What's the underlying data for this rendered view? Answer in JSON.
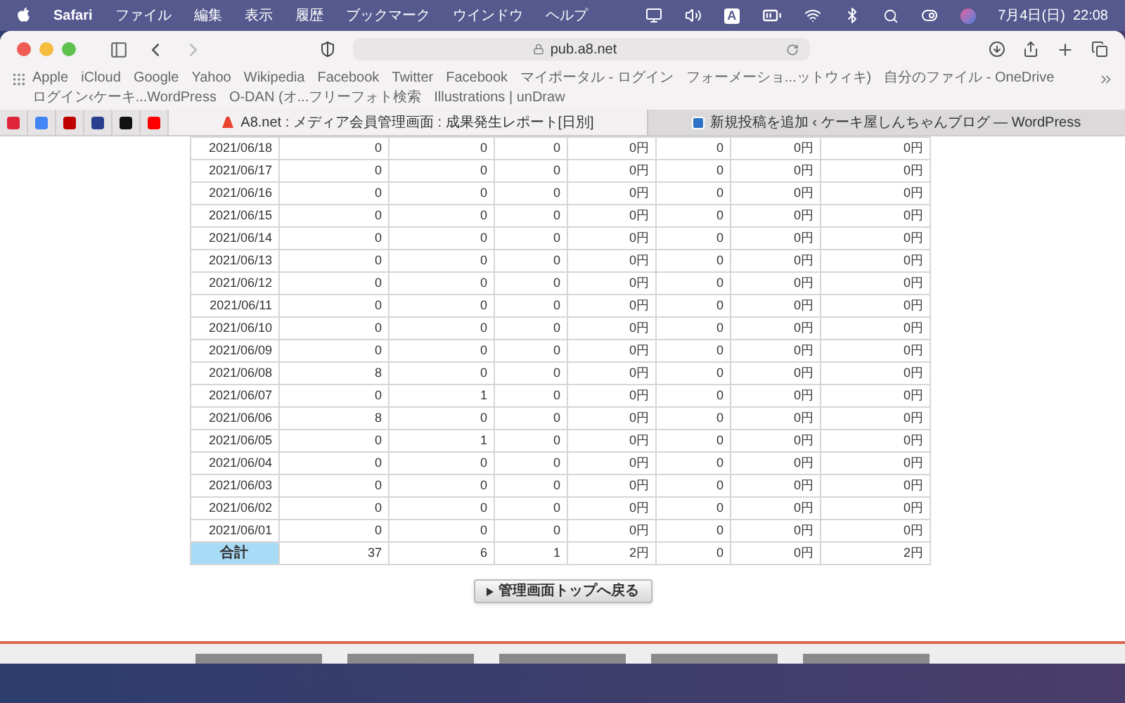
{
  "menu_bar": {
    "app": "Safari",
    "items": [
      "ファイル",
      "編集",
      "表示",
      "履歴",
      "ブックマーク",
      "ウインドウ",
      "ヘルプ"
    ],
    "input_source": "A",
    "clock": "7月4日(日)  22:08"
  },
  "address_bar": {
    "url": "pub.a8.net"
  },
  "bookmarks": [
    "Apple",
    "iCloud",
    "Google",
    "Yahoo",
    "Wikipedia",
    "Facebook",
    "Twitter",
    "Facebook",
    "マイポータル - ログイン",
    "フォーメーショ...ットウィキ)",
    "自分のファイル - OneDrive",
    "ログイン‹ケーキ...WordPress",
    "O-DAN (オ...フリーフォト検索",
    "Illustrations | unDraw"
  ],
  "pinned_tabs": [
    {
      "color": "#e0243a"
    },
    {
      "color": "#4285f4"
    },
    {
      "color": "#bf0000"
    },
    {
      "color": "#2a3f8f"
    },
    {
      "color": "#111111"
    },
    {
      "color": "#ff0000"
    }
  ],
  "tabs": [
    {
      "title": "A8.net : メディア会員管理画面 : 成果発生レポート[日別]",
      "selected": true
    },
    {
      "title": "新規投稿を追加 ‹ ケーキ屋しんちゃんブログ — WordPress",
      "selected": false
    }
  ],
  "table": {
    "rows": [
      {
        "date": "2021/06/18",
        "cells": [
          "0",
          "0",
          "0",
          "0円",
          "0",
          "0円",
          "0円"
        ]
      },
      {
        "date": "2021/06/17",
        "cells": [
          "0",
          "0",
          "0",
          "0円",
          "0",
          "0円",
          "0円"
        ]
      },
      {
        "date": "2021/06/16",
        "cells": [
          "0",
          "0",
          "0",
          "0円",
          "0",
          "0円",
          "0円"
        ]
      },
      {
        "date": "2021/06/15",
        "cells": [
          "0",
          "0",
          "0",
          "0円",
          "0",
          "0円",
          "0円"
        ]
      },
      {
        "date": "2021/06/14",
        "cells": [
          "0",
          "0",
          "0",
          "0円",
          "0",
          "0円",
          "0円"
        ]
      },
      {
        "date": "2021/06/13",
        "cells": [
          "0",
          "0",
          "0",
          "0円",
          "0",
          "0円",
          "0円"
        ]
      },
      {
        "date": "2021/06/12",
        "cells": [
          "0",
          "0",
          "0",
          "0円",
          "0",
          "0円",
          "0円"
        ]
      },
      {
        "date": "2021/06/11",
        "cells": [
          "0",
          "0",
          "0",
          "0円",
          "0",
          "0円",
          "0円"
        ]
      },
      {
        "date": "2021/06/10",
        "cells": [
          "0",
          "0",
          "0",
          "0円",
          "0",
          "0円",
          "0円"
        ]
      },
      {
        "date": "2021/06/09",
        "cells": [
          "0",
          "0",
          "0",
          "0円",
          "0",
          "0円",
          "0円"
        ]
      },
      {
        "date": "2021/06/08",
        "cells": [
          "8",
          "0",
          "0",
          "0円",
          "0",
          "0円",
          "0円"
        ]
      },
      {
        "date": "2021/06/07",
        "cells": [
          "0",
          "1",
          "0",
          "0円",
          "0",
          "0円",
          "0円"
        ]
      },
      {
        "date": "2021/06/06",
        "cells": [
          "8",
          "0",
          "0",
          "0円",
          "0",
          "0円",
          "0円"
        ]
      },
      {
        "date": "2021/06/05",
        "cells": [
          "0",
          "1",
          "0",
          "0円",
          "0",
          "0円",
          "0円"
        ]
      },
      {
        "date": "2021/06/04",
        "cells": [
          "0",
          "0",
          "0",
          "0円",
          "0",
          "0円",
          "0円"
        ]
      },
      {
        "date": "2021/06/03",
        "cells": [
          "0",
          "0",
          "0",
          "0円",
          "0",
          "0円",
          "0円"
        ]
      },
      {
        "date": "2021/06/02",
        "cells": [
          "0",
          "0",
          "0",
          "0円",
          "0",
          "0円",
          "0円"
        ]
      },
      {
        "date": "2021/06/01",
        "cells": [
          "0",
          "0",
          "0",
          "0円",
          "0",
          "0円",
          "0円"
        ]
      }
    ],
    "total": {
      "label": "合計",
      "cells": [
        "37",
        "6",
        "1",
        "2円",
        "0",
        "0円",
        "2円"
      ]
    }
  },
  "back_button": "管理画面トップへ戻る",
  "footer_tabs": [
    {
      "kind": "tab"
    },
    {
      "kind": "tab"
    },
    {
      "kind": "tab"
    },
    {
      "kind": "tab"
    },
    {
      "kind": "tab"
    }
  ]
}
